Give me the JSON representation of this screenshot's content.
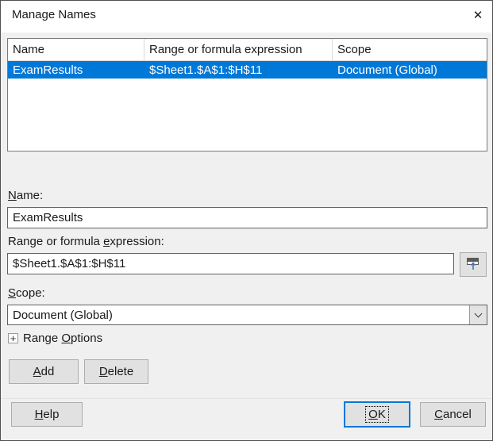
{
  "window": {
    "title": "Manage Names",
    "close_glyph": "✕"
  },
  "names_list": {
    "columns": [
      {
        "label": "Name"
      },
      {
        "label": "Range or formula expression"
      },
      {
        "label": "Scope"
      }
    ],
    "rows": [
      {
        "name": "ExamResults",
        "range": "$Sheet1.$A$1:$H$11",
        "scope": "Document (Global)",
        "selected": true
      }
    ]
  },
  "form": {
    "name_label": {
      "pre": "",
      "key": "N",
      "post": "ame:"
    },
    "name_value": "ExamResults",
    "range_label": {
      "pre": "Range or formula ",
      "key": "e",
      "post": "xpression:"
    },
    "range_value": "$Sheet1.$A$1:$H$11",
    "scope_label": {
      "pre": "",
      "key": "S",
      "post": "cope:"
    },
    "scope_value": "Document (Global)",
    "range_options": {
      "glyph": "+",
      "pre": "Range ",
      "key": "O",
      "post": "ptions"
    }
  },
  "buttons": {
    "add": {
      "pre": "",
      "key": "A",
      "post": "dd"
    },
    "delete": {
      "pre": "",
      "key": "D",
      "post": "elete"
    },
    "help": {
      "pre": "",
      "key": "H",
      "post": "elp"
    },
    "ok": {
      "pre": "",
      "key": "O",
      "post": "K"
    },
    "cancel": {
      "pre": "",
      "key": "C",
      "post": "ancel"
    }
  },
  "colors": {
    "selection": "#0078d7",
    "default_button_border": "#0078d7",
    "button_face": "#e1e1e1",
    "titlebar": "#ffffff"
  }
}
